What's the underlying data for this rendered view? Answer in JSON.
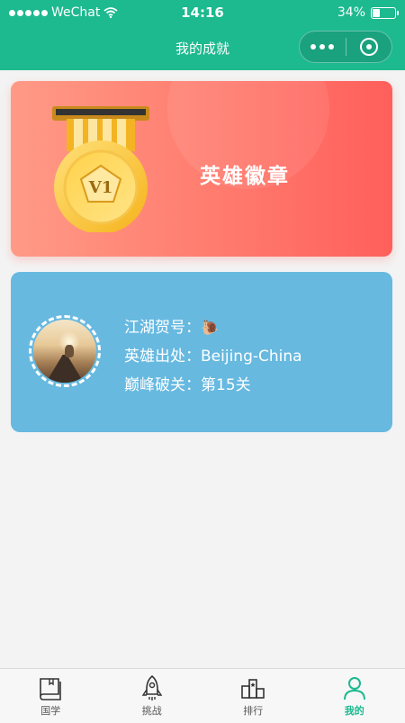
{
  "status_bar": {
    "carrier": "WeChat",
    "time": "14:16",
    "battery": "34%",
    "battery_level": 0.34
  },
  "nav": {
    "title": "我的成就"
  },
  "medal_card": {
    "level": "V1",
    "label": "英雄徽章"
  },
  "profile_card": {
    "rows": [
      {
        "label": "江湖贺号：",
        "value": "🐌"
      },
      {
        "label": "英雄出处：",
        "value": "Beijing-China"
      },
      {
        "label": "巅峰破关：",
        "value": "第15关"
      }
    ]
  },
  "tab_bar": {
    "items": [
      {
        "label": "国学",
        "icon": "book-icon"
      },
      {
        "label": "挑战",
        "icon": "rocket-icon"
      },
      {
        "label": "排行",
        "icon": "podium-icon"
      },
      {
        "label": "我的",
        "icon": "user-icon"
      }
    ],
    "active_index": 3
  },
  "colors": {
    "primary": "#1db98f",
    "medal_card": "#ff7b6e",
    "profile_card": "#67b9e0"
  }
}
